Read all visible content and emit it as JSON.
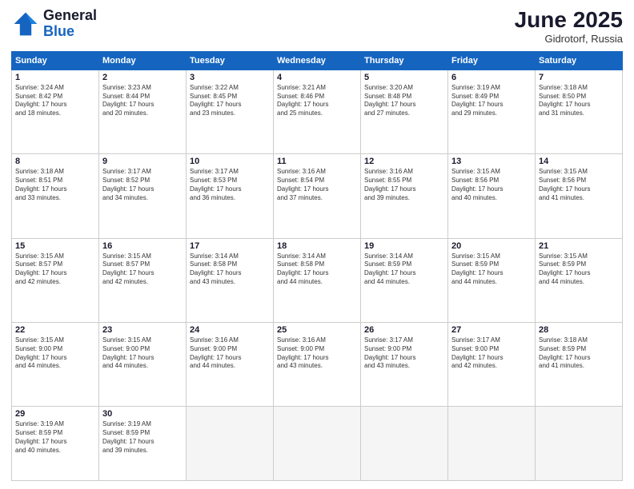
{
  "header": {
    "logo_general": "General",
    "logo_blue": "Blue",
    "month_year": "June 2025",
    "location": "Gidrotorf, Russia"
  },
  "weekdays": [
    "Sunday",
    "Monday",
    "Tuesday",
    "Wednesday",
    "Thursday",
    "Friday",
    "Saturday"
  ],
  "weeks": [
    [
      {
        "day": "1",
        "lines": [
          "Sunrise: 3:24 AM",
          "Sunset: 8:42 PM",
          "Daylight: 17 hours",
          "and 18 minutes."
        ]
      },
      {
        "day": "2",
        "lines": [
          "Sunrise: 3:23 AM",
          "Sunset: 8:44 PM",
          "Daylight: 17 hours",
          "and 20 minutes."
        ]
      },
      {
        "day": "3",
        "lines": [
          "Sunrise: 3:22 AM",
          "Sunset: 8:45 PM",
          "Daylight: 17 hours",
          "and 23 minutes."
        ]
      },
      {
        "day": "4",
        "lines": [
          "Sunrise: 3:21 AM",
          "Sunset: 8:46 PM",
          "Daylight: 17 hours",
          "and 25 minutes."
        ]
      },
      {
        "day": "5",
        "lines": [
          "Sunrise: 3:20 AM",
          "Sunset: 8:48 PM",
          "Daylight: 17 hours",
          "and 27 minutes."
        ]
      },
      {
        "day": "6",
        "lines": [
          "Sunrise: 3:19 AM",
          "Sunset: 8:49 PM",
          "Daylight: 17 hours",
          "and 29 minutes."
        ]
      },
      {
        "day": "7",
        "lines": [
          "Sunrise: 3:18 AM",
          "Sunset: 8:50 PM",
          "Daylight: 17 hours",
          "and 31 minutes."
        ]
      }
    ],
    [
      {
        "day": "8",
        "lines": [
          "Sunrise: 3:18 AM",
          "Sunset: 8:51 PM",
          "Daylight: 17 hours",
          "and 33 minutes."
        ]
      },
      {
        "day": "9",
        "lines": [
          "Sunrise: 3:17 AM",
          "Sunset: 8:52 PM",
          "Daylight: 17 hours",
          "and 34 minutes."
        ]
      },
      {
        "day": "10",
        "lines": [
          "Sunrise: 3:17 AM",
          "Sunset: 8:53 PM",
          "Daylight: 17 hours",
          "and 36 minutes."
        ]
      },
      {
        "day": "11",
        "lines": [
          "Sunrise: 3:16 AM",
          "Sunset: 8:54 PM",
          "Daylight: 17 hours",
          "and 37 minutes."
        ]
      },
      {
        "day": "12",
        "lines": [
          "Sunrise: 3:16 AM",
          "Sunset: 8:55 PM",
          "Daylight: 17 hours",
          "and 39 minutes."
        ]
      },
      {
        "day": "13",
        "lines": [
          "Sunrise: 3:15 AM",
          "Sunset: 8:56 PM",
          "Daylight: 17 hours",
          "and 40 minutes."
        ]
      },
      {
        "day": "14",
        "lines": [
          "Sunrise: 3:15 AM",
          "Sunset: 8:56 PM",
          "Daylight: 17 hours",
          "and 41 minutes."
        ]
      }
    ],
    [
      {
        "day": "15",
        "lines": [
          "Sunrise: 3:15 AM",
          "Sunset: 8:57 PM",
          "Daylight: 17 hours",
          "and 42 minutes."
        ]
      },
      {
        "day": "16",
        "lines": [
          "Sunrise: 3:15 AM",
          "Sunset: 8:57 PM",
          "Daylight: 17 hours",
          "and 42 minutes."
        ]
      },
      {
        "day": "17",
        "lines": [
          "Sunrise: 3:14 AM",
          "Sunset: 8:58 PM",
          "Daylight: 17 hours",
          "and 43 minutes."
        ]
      },
      {
        "day": "18",
        "lines": [
          "Sunrise: 3:14 AM",
          "Sunset: 8:58 PM",
          "Daylight: 17 hours",
          "and 44 minutes."
        ]
      },
      {
        "day": "19",
        "lines": [
          "Sunrise: 3:14 AM",
          "Sunset: 8:59 PM",
          "Daylight: 17 hours",
          "and 44 minutes."
        ]
      },
      {
        "day": "20",
        "lines": [
          "Sunrise: 3:15 AM",
          "Sunset: 8:59 PM",
          "Daylight: 17 hours",
          "and 44 minutes."
        ]
      },
      {
        "day": "21",
        "lines": [
          "Sunrise: 3:15 AM",
          "Sunset: 8:59 PM",
          "Daylight: 17 hours",
          "and 44 minutes."
        ]
      }
    ],
    [
      {
        "day": "22",
        "lines": [
          "Sunrise: 3:15 AM",
          "Sunset: 9:00 PM",
          "Daylight: 17 hours",
          "and 44 minutes."
        ]
      },
      {
        "day": "23",
        "lines": [
          "Sunrise: 3:15 AM",
          "Sunset: 9:00 PM",
          "Daylight: 17 hours",
          "and 44 minutes."
        ]
      },
      {
        "day": "24",
        "lines": [
          "Sunrise: 3:16 AM",
          "Sunset: 9:00 PM",
          "Daylight: 17 hours",
          "and 44 minutes."
        ]
      },
      {
        "day": "25",
        "lines": [
          "Sunrise: 3:16 AM",
          "Sunset: 9:00 PM",
          "Daylight: 17 hours",
          "and 43 minutes."
        ]
      },
      {
        "day": "26",
        "lines": [
          "Sunrise: 3:17 AM",
          "Sunset: 9:00 PM",
          "Daylight: 17 hours",
          "and 43 minutes."
        ]
      },
      {
        "day": "27",
        "lines": [
          "Sunrise: 3:17 AM",
          "Sunset: 9:00 PM",
          "Daylight: 17 hours",
          "and 42 minutes."
        ]
      },
      {
        "day": "28",
        "lines": [
          "Sunrise: 3:18 AM",
          "Sunset: 8:59 PM",
          "Daylight: 17 hours",
          "and 41 minutes."
        ]
      }
    ],
    [
      {
        "day": "29",
        "lines": [
          "Sunrise: 3:19 AM",
          "Sunset: 8:59 PM",
          "Daylight: 17 hours",
          "and 40 minutes."
        ]
      },
      {
        "day": "30",
        "lines": [
          "Sunrise: 3:19 AM",
          "Sunset: 8:59 PM",
          "Daylight: 17 hours",
          "and 39 minutes."
        ]
      },
      {
        "day": "",
        "lines": []
      },
      {
        "day": "",
        "lines": []
      },
      {
        "day": "",
        "lines": []
      },
      {
        "day": "",
        "lines": []
      },
      {
        "day": "",
        "lines": []
      }
    ]
  ]
}
